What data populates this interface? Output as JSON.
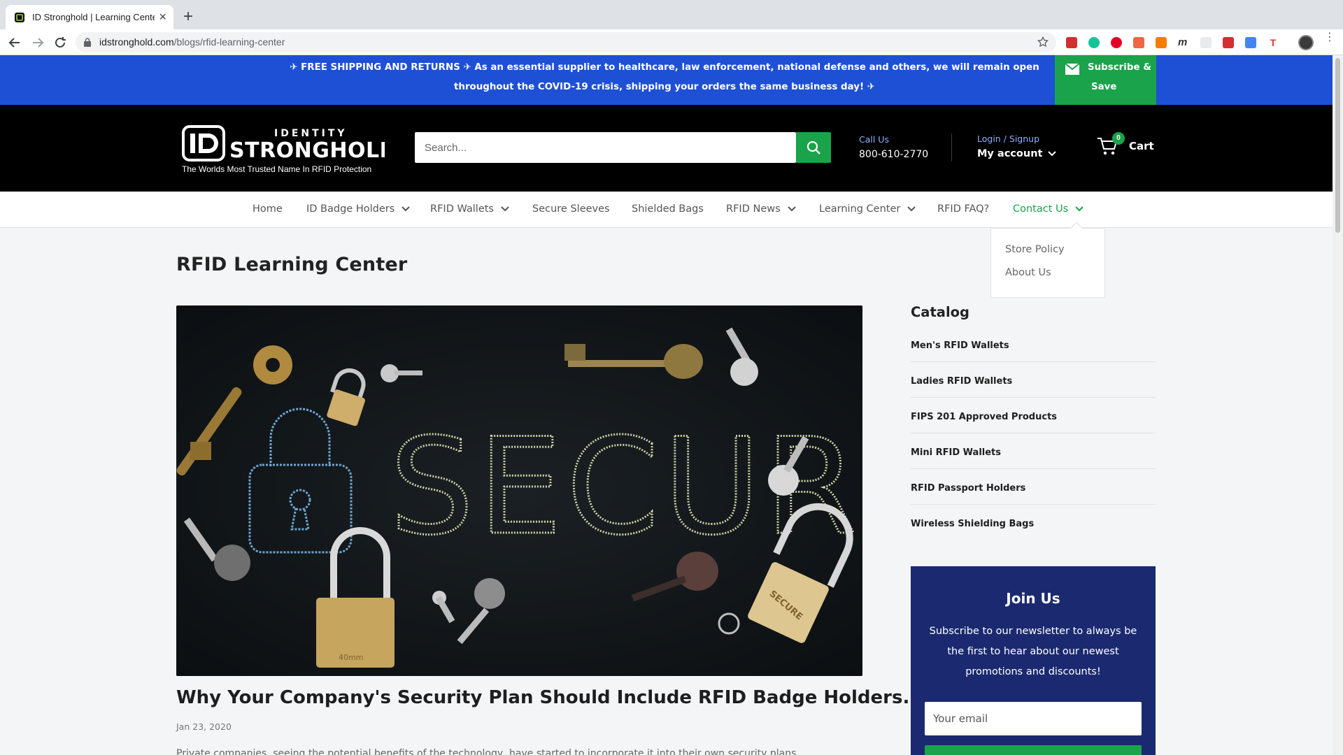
{
  "browser": {
    "tab_title": "ID Stronghold | Learning Cente",
    "url_domain": "idstronghold.com",
    "url_path": "/blogs/rfid-learning-center"
  },
  "announcement": {
    "message": "✈ FREE SHIPPING AND RETURNS ✈ As an essential supplier to healthcare, law enforcement, national defense and others, we will remain open throughout the COVID-19 crisis, shipping your orders the same business day! ✈",
    "subscribe_line1": "Subscribe &",
    "subscribe_line2": "Save"
  },
  "header": {
    "logo_tagline": "The Worlds Most Trusted Name In RFID Protection",
    "logo_top": "IDENTITY",
    "logo_main": "STRONGHOLD",
    "search_placeholder": "Search...",
    "call_label": "Call Us",
    "phone": "800-610-2770",
    "login_label": "Login / Signup",
    "account_label": "My account",
    "cart_count": "0",
    "cart_label": "Cart"
  },
  "nav": {
    "items": [
      {
        "label": "Home"
      },
      {
        "label": "ID Badge Holders"
      },
      {
        "label": "RFID Wallets"
      },
      {
        "label": "Secure Sleeves"
      },
      {
        "label": "Shielded Bags"
      },
      {
        "label": "RFID News"
      },
      {
        "label": "Learning Center"
      },
      {
        "label": "RFID FAQ?"
      },
      {
        "label": "Contact Us"
      }
    ],
    "dropdown": [
      "Store Policy",
      "About Us"
    ]
  },
  "main": {
    "page_title": "RFID Learning Center",
    "hero_word": "SECURE",
    "padlock_label": "40mm",
    "padlock_tag": "SECURE",
    "article_title": "Why Your Company's Security Plan Should Include RFID Badge Holders.",
    "article_date": "Jan 23, 2020",
    "excerpt": "Private companies, seeing the potential benefits of the technology, have started to incorporate it into their own security plans."
  },
  "sidebar": {
    "catalog_title": "Catalog",
    "items": [
      "Men's RFID Wallets",
      "Ladies RFID Wallets",
      "FIPS 201 Approved Products",
      "Mini RFID Wallets",
      "RFID Passport Holders",
      "Wireless Shielding Bags"
    ],
    "join_title": "Join Us",
    "join_text": "Subscribe to our newsletter to always be the first to hear about our newest promotions and discounts!",
    "email_placeholder": "Your email"
  },
  "colors": {
    "announce_blue": "#1e50d5",
    "brand_green": "#1aa34a",
    "join_navy": "#1b2a70"
  }
}
